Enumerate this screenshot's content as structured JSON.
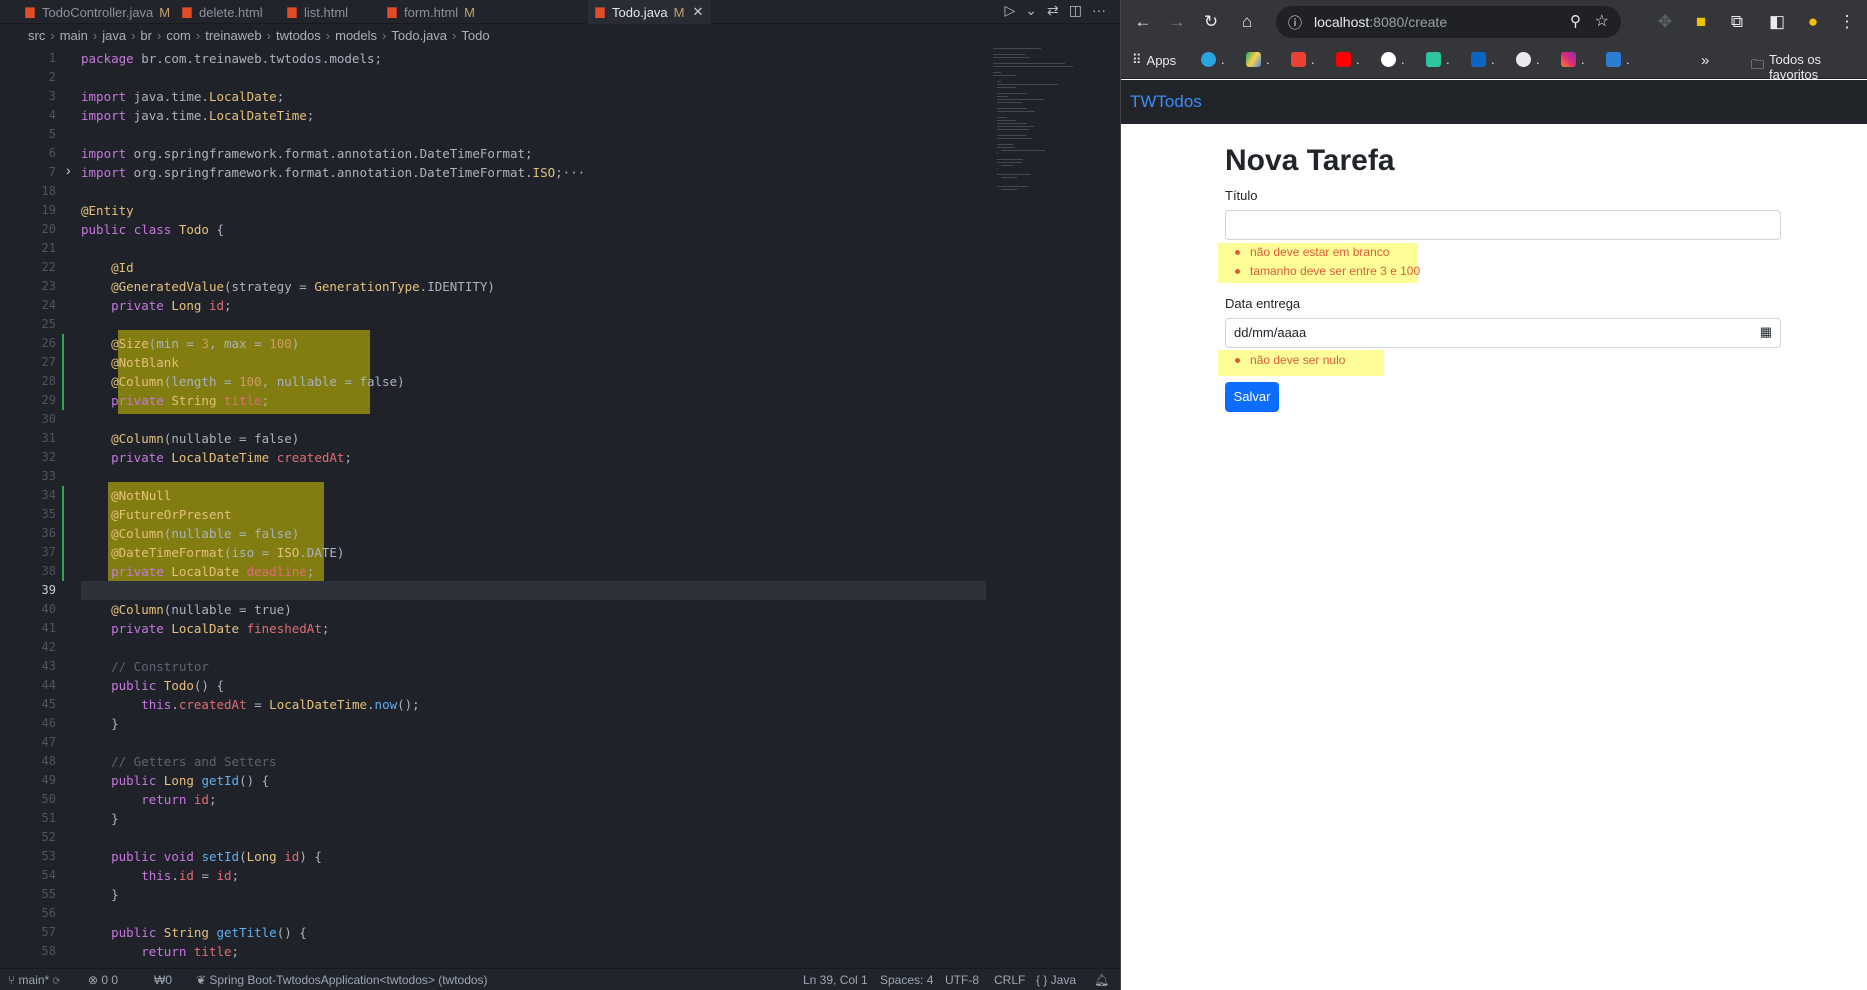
{
  "editor": {
    "tabs": [
      {
        "label": "TodoController.java",
        "mod": "M",
        "active": false
      },
      {
        "label": "delete.html",
        "mod": "",
        "active": false
      },
      {
        "label": "list.html",
        "mod": "",
        "active": false
      },
      {
        "label": "form.html",
        "mod": "M",
        "active": false
      },
      {
        "label": "Todo.java",
        "mod": "M",
        "active": true
      }
    ],
    "breadcrumb": [
      "src",
      "main",
      "java",
      "br",
      "com",
      "treinaweb",
      "twtodos",
      "models",
      "Todo.java",
      "Todo"
    ],
    "lines": [
      {
        "n": "1",
        "t": "package br.com.treinaweb.twtodos.models;"
      },
      {
        "n": "2",
        "t": ""
      },
      {
        "n": "3",
        "t": "import java.time.LocalDate;"
      },
      {
        "n": "4",
        "t": "import java.time.LocalDateTime;"
      },
      {
        "n": "5",
        "t": ""
      },
      {
        "n": "6",
        "t": "import org.springframework.format.annotation.DateTimeFormat;"
      },
      {
        "n": "7",
        "t": "import org.springframework.format.annotation.DateTimeFormat.ISO;···"
      },
      {
        "n": "18",
        "t": ""
      },
      {
        "n": "19",
        "t": "@Entity"
      },
      {
        "n": "20",
        "t": "public class Todo {"
      },
      {
        "n": "21",
        "t": ""
      },
      {
        "n": "22",
        "t": "    @Id"
      },
      {
        "n": "23",
        "t": "    @GeneratedValue(strategy = GenerationType.IDENTITY)"
      },
      {
        "n": "24",
        "t": "    private Long id;"
      },
      {
        "n": "25",
        "t": ""
      },
      {
        "n": "26",
        "t": "    @Size(min = 3, max = 100)"
      },
      {
        "n": "27",
        "t": "    @NotBlank"
      },
      {
        "n": "28",
        "t": "    @Column(length = 100, nullable = false)"
      },
      {
        "n": "29",
        "t": "    private String title;"
      },
      {
        "n": "30",
        "t": ""
      },
      {
        "n": "31",
        "t": "    @Column(nullable = false)"
      },
      {
        "n": "32",
        "t": "    private LocalDateTime createdAt;"
      },
      {
        "n": "33",
        "t": ""
      },
      {
        "n": "34",
        "t": "    @NotNull"
      },
      {
        "n": "35",
        "t": "    @FutureOrPresent"
      },
      {
        "n": "36",
        "t": "    @Column(nullable = false)"
      },
      {
        "n": "37",
        "t": "    @DateTimeFormat(iso = ISO.DATE)"
      },
      {
        "n": "38",
        "t": "    private LocalDate deadline;"
      },
      {
        "n": "39",
        "t": ""
      },
      {
        "n": "40",
        "t": "    @Column(nullable = true)"
      },
      {
        "n": "41",
        "t": "    private LocalDate fineshedAt;"
      },
      {
        "n": "42",
        "t": ""
      },
      {
        "n": "43",
        "t": "    // Construtor"
      },
      {
        "n": "44",
        "t": "    public Todo() {"
      },
      {
        "n": "45",
        "t": "        this.createdAt = LocalDateTime.now();"
      },
      {
        "n": "46",
        "t": "    }"
      },
      {
        "n": "47",
        "t": ""
      },
      {
        "n": "48",
        "t": "    // Getters and Setters"
      },
      {
        "n": "49",
        "t": "    public Long getId() {"
      },
      {
        "n": "50",
        "t": "        return id;"
      },
      {
        "n": "51",
        "t": "    }"
      },
      {
        "n": "52",
        "t": ""
      },
      {
        "n": "53",
        "t": "    public void setId(Long id) {"
      },
      {
        "n": "54",
        "t": "        this.id = id;"
      },
      {
        "n": "55",
        "t": "    }"
      },
      {
        "n": "56",
        "t": ""
      },
      {
        "n": "57",
        "t": "    public String getTitle() {"
      },
      {
        "n": "58",
        "t": "        return title;"
      }
    ],
    "status": {
      "branch": "main*",
      "problems": "0 0",
      "ports": "0",
      "spring": "Spring Boot-TwtodosApplication<twtodos> (twtodos)",
      "position": "Ln 39, Col 1",
      "spaces": "Spaces: 4",
      "encoding": "UTF-8",
      "eol": "CRLF",
      "language": "{ } Java"
    }
  },
  "browser": {
    "url_host": "localhost",
    "url_rest": ":8080/create",
    "bookmarks": {
      "apps": "Apps",
      "favorites": "Todos os favoritos"
    },
    "page": {
      "brand": "TWTodos",
      "title": "Nova Tarefa",
      "titulo_label": "Título",
      "titulo_value": "",
      "titulo_errors": [
        "não deve estar em branco",
        "tamanho deve ser entre 3 e 100"
      ],
      "data_label": "Data entrega",
      "data_placeholder": "dd/mm/aaaa",
      "data_errors": [
        "não deve ser nulo"
      ],
      "save": "Salvar"
    }
  }
}
